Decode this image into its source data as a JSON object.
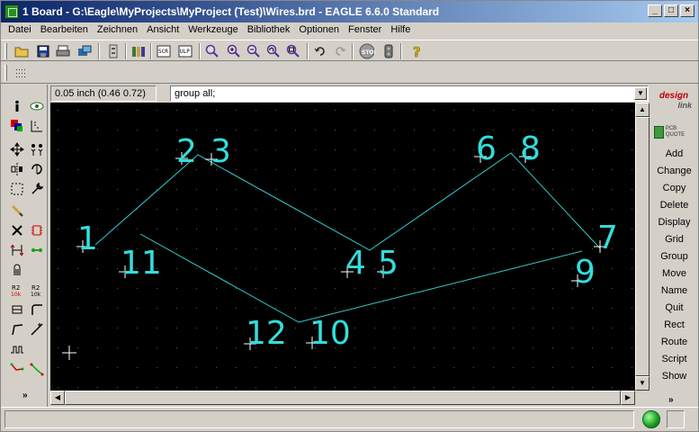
{
  "window": {
    "title": "1 Board - G:\\Eagle\\MyProjects\\MyProject (Test)\\Wires.brd - EAGLE 6.6.0 Standard",
    "buttons": {
      "minimize": "_",
      "maximize": "□",
      "close": "×"
    }
  },
  "menu": [
    "Datei",
    "Bearbeiten",
    "Zeichnen",
    "Ansicht",
    "Werkzeuge",
    "Bibliothek",
    "Optionen",
    "Fenster",
    "Hilfe"
  ],
  "coordinates": "0.05 inch (0.46 0.72)",
  "command_line": "group all;",
  "right_panel": {
    "logo_main": "design",
    "logo_sub": "link",
    "pcb_quote": "PCB QUOTE",
    "commands": [
      "Add",
      "Change",
      "Copy",
      "Delete",
      "Display",
      "Grid",
      "Group",
      "Move",
      "Name",
      "Quit",
      "Rect",
      "Route",
      "Script",
      "Show"
    ]
  },
  "canvas": {
    "labels": [
      "1",
      "2",
      "3",
      "4",
      "5",
      "6",
      "8",
      "7",
      "9",
      "10",
      "11",
      "12"
    ]
  },
  "colors": {
    "wire": "#33cccc",
    "label": "#33dddd",
    "grid_dot": "#5a5a5a",
    "canvas_bg": "#000000"
  }
}
